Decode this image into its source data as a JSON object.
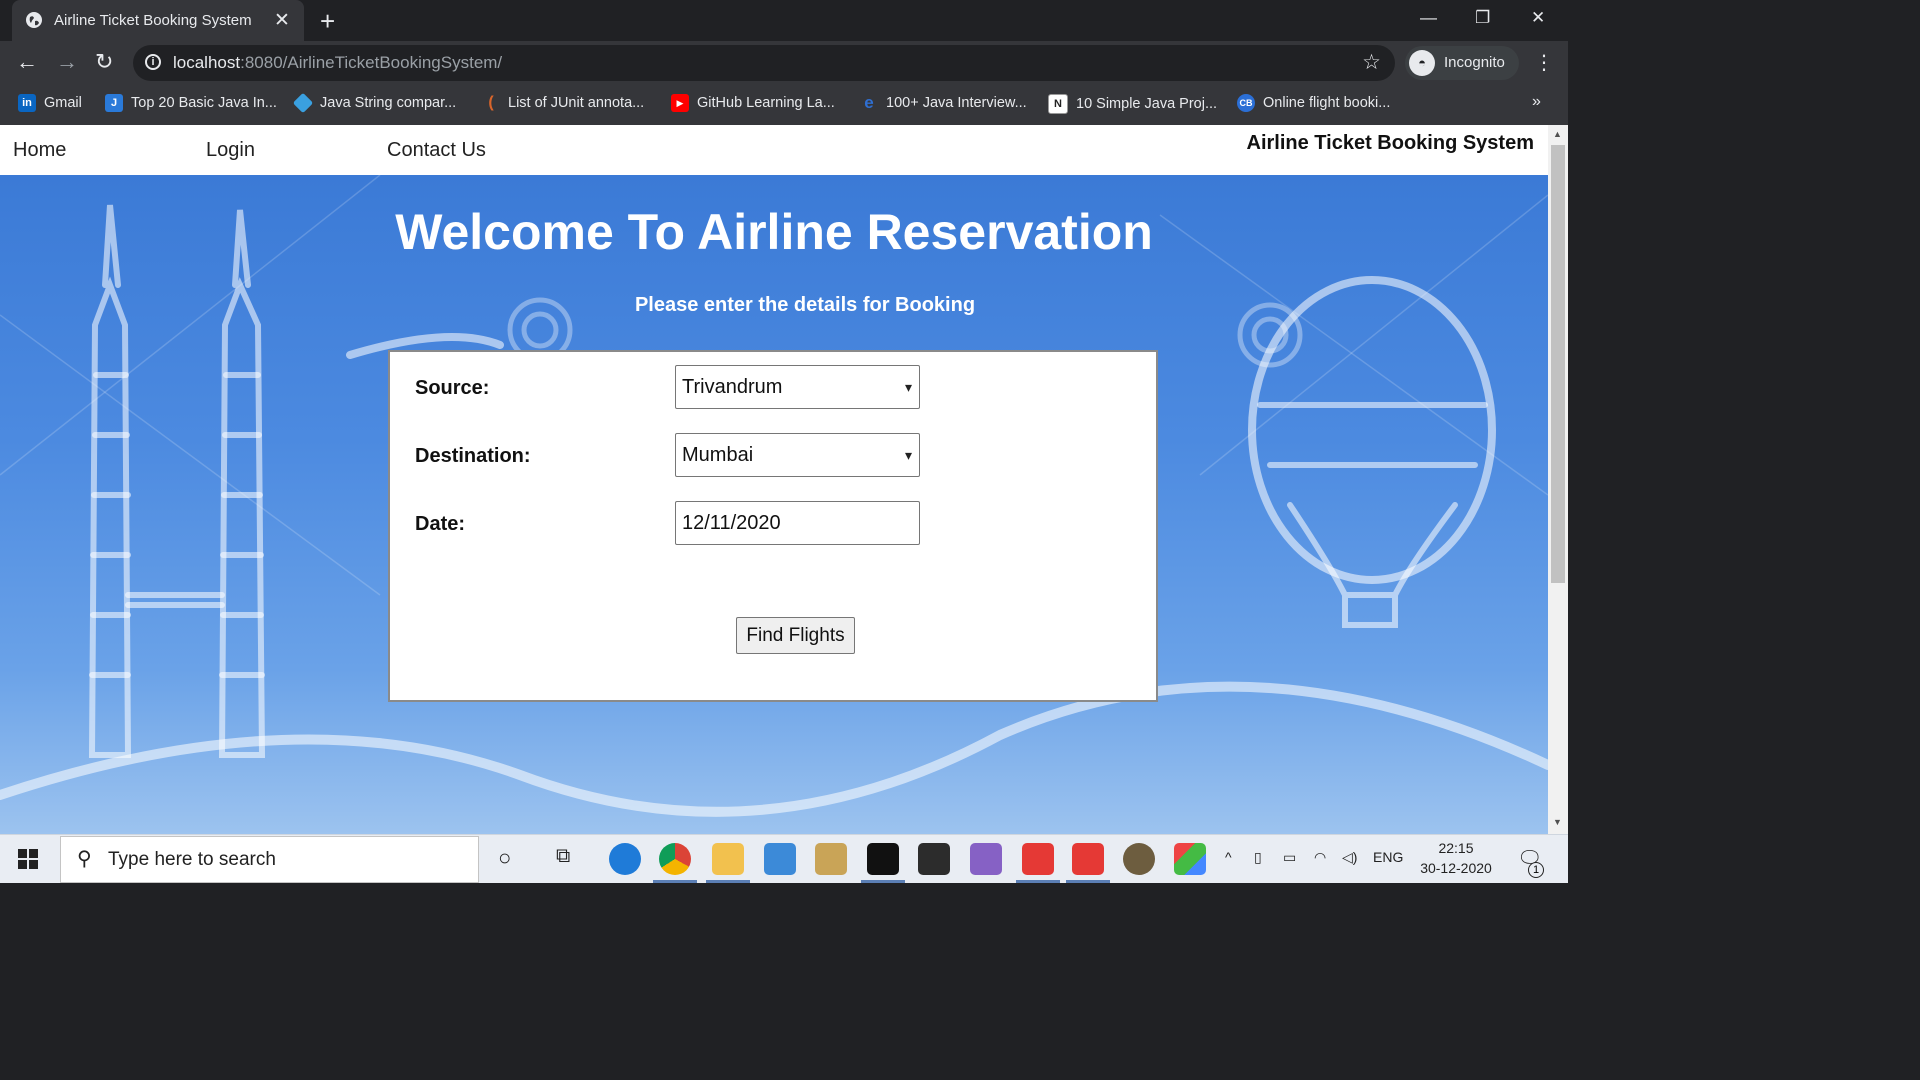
{
  "browser": {
    "tab_title": "Airline Ticket Booking System",
    "url_host": "localhost",
    "url_path": ":8080/AirlineTicketBookingSystem/",
    "profile_label": "Incognito",
    "bookmarks": [
      {
        "label": "Gmail",
        "icon": "linkedin-icon",
        "color": "#0a66c2"
      },
      {
        "label": "Top 20 Basic Java In...",
        "icon": "java-doc-icon",
        "color": "#2a7ad9"
      },
      {
        "label": "Java String compar...",
        "icon": "diamond-icon",
        "color": "#3aa0e0"
      },
      {
        "label": "List of JUnit annota...",
        "icon": "feather-icon",
        "color": "#d9652b"
      },
      {
        "label": "GitHub Learning La...",
        "icon": "youtube-icon",
        "color": "#ff0000"
      },
      {
        "label": "100+ Java Interview...",
        "icon": "e-icon",
        "color": "#2f6fd1"
      },
      {
        "label": "10 Simple Java Proj...",
        "icon": "n-icon",
        "color": "#222222"
      },
      {
        "label": "Online flight booki...",
        "icon": "cb-icon",
        "color": "#2b6fd6"
      }
    ]
  },
  "site": {
    "nav": {
      "home": "Home",
      "login": "Login",
      "contact": "Contact Us"
    },
    "brand": "Airline Ticket Booking System",
    "heading": "Welcome To Airline Reservation",
    "subheading": "Please enter the details for Booking",
    "form": {
      "source_label": "Source:",
      "source_value": "Trivandrum",
      "destination_label": "Destination:",
      "destination_value": "Mumbai",
      "date_label": "Date:",
      "date_value": "12/11/2020",
      "submit_label": "Find Flights"
    }
  },
  "taskbar": {
    "search_placeholder": "Type here to search",
    "language": "ENG",
    "time": "22:15",
    "date": "30-12-2020",
    "notification_count": "1"
  }
}
